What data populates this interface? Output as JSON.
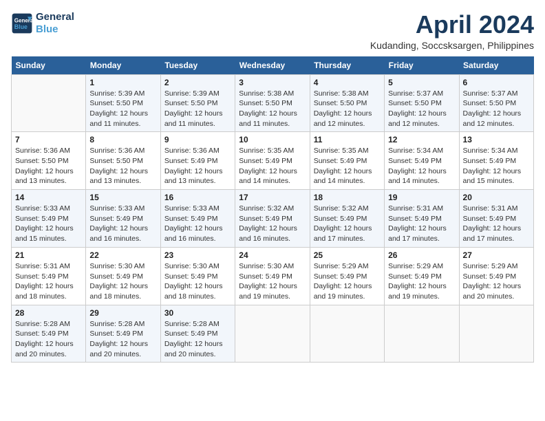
{
  "header": {
    "logo_line1": "General",
    "logo_line2": "Blue",
    "month_title": "April 2024",
    "location": "Kudanding, Soccsksargen, Philippines"
  },
  "weekdays": [
    "Sunday",
    "Monday",
    "Tuesday",
    "Wednesday",
    "Thursday",
    "Friday",
    "Saturday"
  ],
  "weeks": [
    [
      {
        "day": "",
        "info": ""
      },
      {
        "day": "1",
        "info": "Sunrise: 5:39 AM\nSunset: 5:50 PM\nDaylight: 12 hours\nand 11 minutes."
      },
      {
        "day": "2",
        "info": "Sunrise: 5:39 AM\nSunset: 5:50 PM\nDaylight: 12 hours\nand 11 minutes."
      },
      {
        "day": "3",
        "info": "Sunrise: 5:38 AM\nSunset: 5:50 PM\nDaylight: 12 hours\nand 11 minutes."
      },
      {
        "day": "4",
        "info": "Sunrise: 5:38 AM\nSunset: 5:50 PM\nDaylight: 12 hours\nand 12 minutes."
      },
      {
        "day": "5",
        "info": "Sunrise: 5:37 AM\nSunset: 5:50 PM\nDaylight: 12 hours\nand 12 minutes."
      },
      {
        "day": "6",
        "info": "Sunrise: 5:37 AM\nSunset: 5:50 PM\nDaylight: 12 hours\nand 12 minutes."
      }
    ],
    [
      {
        "day": "7",
        "info": "Sunrise: 5:36 AM\nSunset: 5:50 PM\nDaylight: 12 hours\nand 13 minutes."
      },
      {
        "day": "8",
        "info": "Sunrise: 5:36 AM\nSunset: 5:50 PM\nDaylight: 12 hours\nand 13 minutes."
      },
      {
        "day": "9",
        "info": "Sunrise: 5:36 AM\nSunset: 5:49 PM\nDaylight: 12 hours\nand 13 minutes."
      },
      {
        "day": "10",
        "info": "Sunrise: 5:35 AM\nSunset: 5:49 PM\nDaylight: 12 hours\nand 14 minutes."
      },
      {
        "day": "11",
        "info": "Sunrise: 5:35 AM\nSunset: 5:49 PM\nDaylight: 12 hours\nand 14 minutes."
      },
      {
        "day": "12",
        "info": "Sunrise: 5:34 AM\nSunset: 5:49 PM\nDaylight: 12 hours\nand 14 minutes."
      },
      {
        "day": "13",
        "info": "Sunrise: 5:34 AM\nSunset: 5:49 PM\nDaylight: 12 hours\nand 15 minutes."
      }
    ],
    [
      {
        "day": "14",
        "info": "Sunrise: 5:33 AM\nSunset: 5:49 PM\nDaylight: 12 hours\nand 15 minutes."
      },
      {
        "day": "15",
        "info": "Sunrise: 5:33 AM\nSunset: 5:49 PM\nDaylight: 12 hours\nand 16 minutes."
      },
      {
        "day": "16",
        "info": "Sunrise: 5:33 AM\nSunset: 5:49 PM\nDaylight: 12 hours\nand 16 minutes."
      },
      {
        "day": "17",
        "info": "Sunrise: 5:32 AM\nSunset: 5:49 PM\nDaylight: 12 hours\nand 16 minutes."
      },
      {
        "day": "18",
        "info": "Sunrise: 5:32 AM\nSunset: 5:49 PM\nDaylight: 12 hours\nand 17 minutes."
      },
      {
        "day": "19",
        "info": "Sunrise: 5:31 AM\nSunset: 5:49 PM\nDaylight: 12 hours\nand 17 minutes."
      },
      {
        "day": "20",
        "info": "Sunrise: 5:31 AM\nSunset: 5:49 PM\nDaylight: 12 hours\nand 17 minutes."
      }
    ],
    [
      {
        "day": "21",
        "info": "Sunrise: 5:31 AM\nSunset: 5:49 PM\nDaylight: 12 hours\nand 18 minutes."
      },
      {
        "day": "22",
        "info": "Sunrise: 5:30 AM\nSunset: 5:49 PM\nDaylight: 12 hours\nand 18 minutes."
      },
      {
        "day": "23",
        "info": "Sunrise: 5:30 AM\nSunset: 5:49 PM\nDaylight: 12 hours\nand 18 minutes."
      },
      {
        "day": "24",
        "info": "Sunrise: 5:30 AM\nSunset: 5:49 PM\nDaylight: 12 hours\nand 19 minutes."
      },
      {
        "day": "25",
        "info": "Sunrise: 5:29 AM\nSunset: 5:49 PM\nDaylight: 12 hours\nand 19 minutes."
      },
      {
        "day": "26",
        "info": "Sunrise: 5:29 AM\nSunset: 5:49 PM\nDaylight: 12 hours\nand 19 minutes."
      },
      {
        "day": "27",
        "info": "Sunrise: 5:29 AM\nSunset: 5:49 PM\nDaylight: 12 hours\nand 20 minutes."
      }
    ],
    [
      {
        "day": "28",
        "info": "Sunrise: 5:28 AM\nSunset: 5:49 PM\nDaylight: 12 hours\nand 20 minutes."
      },
      {
        "day": "29",
        "info": "Sunrise: 5:28 AM\nSunset: 5:49 PM\nDaylight: 12 hours\nand 20 minutes."
      },
      {
        "day": "30",
        "info": "Sunrise: 5:28 AM\nSunset: 5:49 PM\nDaylight: 12 hours\nand 20 minutes."
      },
      {
        "day": "",
        "info": ""
      },
      {
        "day": "",
        "info": ""
      },
      {
        "day": "",
        "info": ""
      },
      {
        "day": "",
        "info": ""
      }
    ]
  ]
}
